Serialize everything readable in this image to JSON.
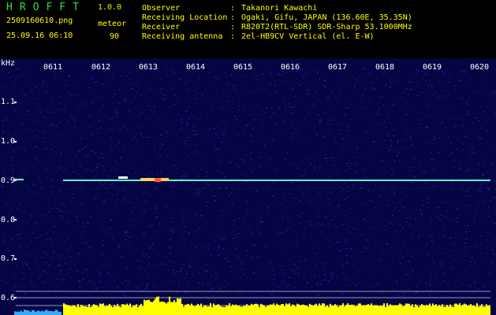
{
  "header": {
    "app_name": "HROFFT",
    "version": "1.0.0",
    "filename": "2509160610.png",
    "datetime": "25.09.16 06:10",
    "event_label": "meteor",
    "event_count": "90",
    "info": [
      {
        "key": "Observer",
        "sep": ":",
        "value": "Takanori Kawachi"
      },
      {
        "key": "Receiving Location",
        "sep": ":",
        "value": "Ogaki, Gifu, JAPAN (136.60E, 35.35N)"
      },
      {
        "key": "Receiver",
        "sep": ":",
        "value": "R820T2(RTL-SDR) SDR-Sharp 53.1000MHz"
      },
      {
        "key": "Receiving antenna",
        "sep": ":",
        "value": "2el-HB9CV Vertical (el. E-W)"
      }
    ]
  },
  "spectrogram": {
    "unit": "kHz",
    "time_ticks": [
      "0611",
      "0612",
      "0613",
      "0614",
      "0615",
      "0616",
      "0617",
      "0618",
      "0619",
      "0620"
    ],
    "freq_ticks": [
      "1.1",
      "1.0",
      "0.9",
      "0.8",
      "0.7",
      "0.6"
    ],
    "colors": {
      "background": "#050544",
      "carrier": "#66ffcc",
      "amplitude": "#ffff00",
      "amplitude_low": "#33aaff",
      "guide_line": "#9999cc"
    }
  }
}
